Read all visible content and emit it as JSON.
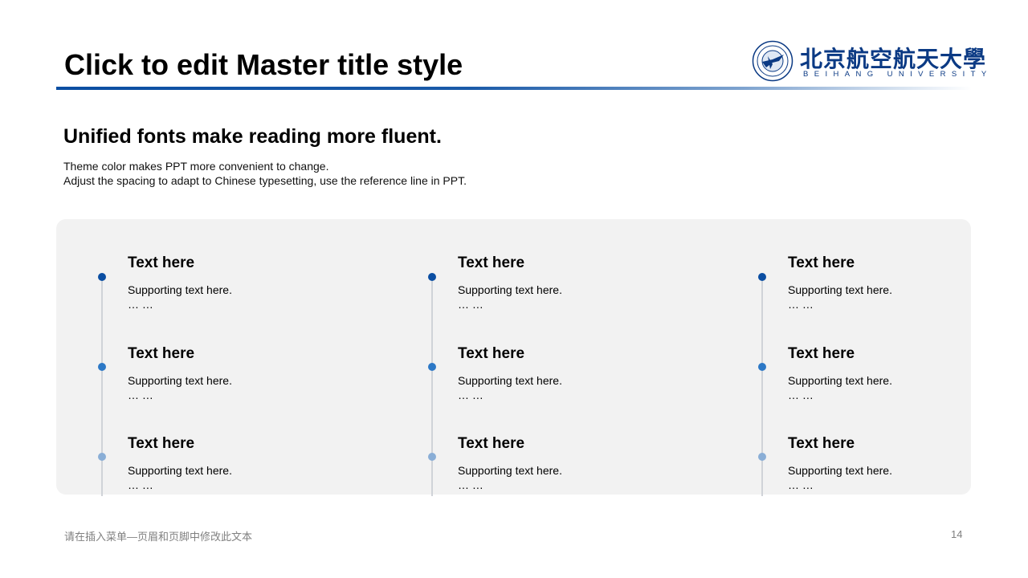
{
  "slide": {
    "title": "Click to edit Master title style",
    "subtitle": "Unified fonts make reading more fluent.",
    "description_line1": "Theme color makes PPT more convenient  to change.",
    "description_line2": "Adjust  the  spacing  to adapt  to Chinese  typesetting,  use  the  reference line  in  PPT."
  },
  "logo": {
    "name_cn": "北京航空航天大學",
    "name_en": "BEIHANG UNIVERSITY"
  },
  "columns": [
    {
      "items": [
        {
          "title": "Text here",
          "text": "Supporting  text here.",
          "ellipsis": "… …"
        },
        {
          "title": "Text here",
          "text": "Supporting  text here.",
          "ellipsis": "… …"
        },
        {
          "title": "Text here",
          "text": "Supporting  text here.",
          "ellipsis": "… …"
        }
      ]
    },
    {
      "items": [
        {
          "title": "Text here",
          "text": "Supporting  text here.",
          "ellipsis": "… …"
        },
        {
          "title": "Text here",
          "text": "Supporting  text here.",
          "ellipsis": "… …"
        },
        {
          "title": "Text here",
          "text": "Supporting  text here.",
          "ellipsis": "… …"
        }
      ]
    },
    {
      "items": [
        {
          "title": "Text here",
          "text": "Supporting  text here.",
          "ellipsis": "… …"
        },
        {
          "title": "Text here",
          "text": "Supporting  text here.",
          "ellipsis": "… …"
        },
        {
          "title": "Text here",
          "text": "Supporting  text here.",
          "ellipsis": "… …"
        }
      ]
    }
  ],
  "colors": {
    "dot_1": "#0b4ea2",
    "dot_2": "#2c78c6",
    "dot_3": "#8aaed6",
    "brand": "#0b3a84"
  },
  "footer": {
    "text": "请在插入菜单—页眉和页脚中修改此文本",
    "page_number": "14"
  }
}
